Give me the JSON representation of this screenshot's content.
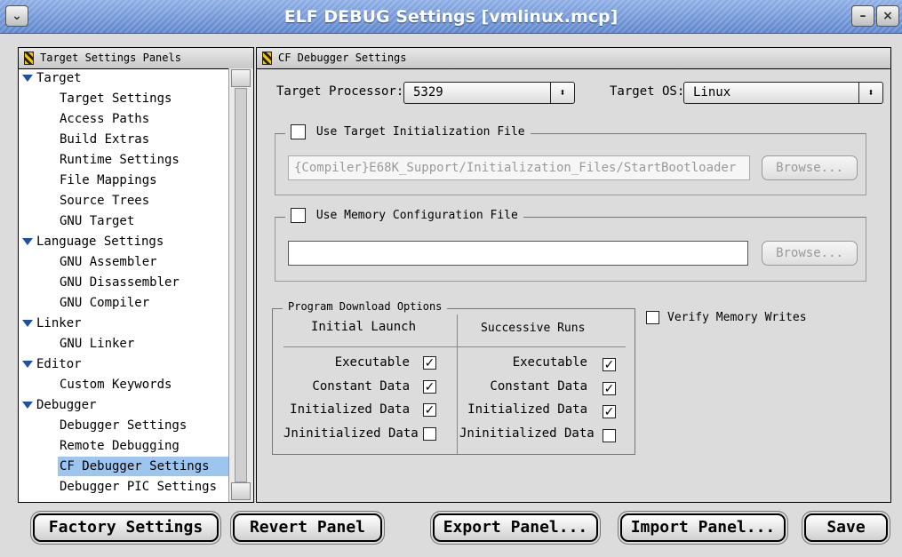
{
  "window": {
    "title": "ELF DEBUG Settings [vmlinux.mcp]",
    "collapse_icon": "collapse-icon",
    "minimize_label": "–",
    "close_label": "×"
  },
  "left_panel": {
    "header": "Target Settings Panels",
    "tree": [
      {
        "label": "Target",
        "level": 0,
        "expanded": true
      },
      {
        "label": "Target Settings",
        "level": 1
      },
      {
        "label": "Access Paths",
        "level": 1
      },
      {
        "label": "Build Extras",
        "level": 1
      },
      {
        "label": "Runtime Settings",
        "level": 1
      },
      {
        "label": "File Mappings",
        "level": 1
      },
      {
        "label": "Source Trees",
        "level": 1
      },
      {
        "label": "GNU Target",
        "level": 1
      },
      {
        "label": "Language Settings",
        "level": 0,
        "expanded": true
      },
      {
        "label": "GNU Assembler",
        "level": 1
      },
      {
        "label": "GNU Disassembler",
        "level": 1
      },
      {
        "label": "GNU Compiler",
        "level": 1
      },
      {
        "label": "Linker",
        "level": 0,
        "expanded": true
      },
      {
        "label": "GNU Linker",
        "level": 1
      },
      {
        "label": "Editor",
        "level": 0,
        "expanded": true
      },
      {
        "label": "Custom Keywords",
        "level": 1
      },
      {
        "label": "Debugger",
        "level": 0,
        "expanded": true
      },
      {
        "label": "Debugger Settings",
        "level": 1
      },
      {
        "label": "Remote Debugging",
        "level": 1
      },
      {
        "label": "CF Debugger Settings",
        "level": 1,
        "selected": true
      },
      {
        "label": "Debugger PIC Settings",
        "level": 1
      }
    ]
  },
  "right_panel": {
    "header": "CF Debugger Settings",
    "target_processor": {
      "label": "Target Processor:",
      "value": "5329"
    },
    "target_os": {
      "label": "Target OS:",
      "value": "Linux"
    },
    "init_file": {
      "label": "Use Target Initialization File",
      "checked": false,
      "path": "{Compiler}E68K_Support/Initialization_Files/StartBootloader",
      "browse": "Browse..."
    },
    "mem_config": {
      "label": "Use Memory Configuration File",
      "checked": false,
      "path": "",
      "browse": "Browse..."
    },
    "download": {
      "legend": "Program Download Options",
      "initial_header": "Initial Launch",
      "successive_header": "Successive Runs",
      "rows": [
        {
          "label": "Executable",
          "initial": true,
          "successive": true
        },
        {
          "label": "Constant Data",
          "initial": true,
          "successive": true
        },
        {
          "label": "Initialized Data",
          "initial": true,
          "successive": true
        },
        {
          "label": "Jninitialized Data",
          "initial": false,
          "successive": false
        }
      ]
    },
    "verify": {
      "label": "Verify Memory Writes",
      "checked": false
    }
  },
  "buttons": {
    "factory": "Factory Settings",
    "revert": "Revert Panel",
    "export": "Export Panel...",
    "import": "Import Panel...",
    "save": "Save"
  },
  "colors": {
    "titlebar": "#6f93d6",
    "selection": "#9cc6f0",
    "tree_triangle": "#1f4fa8"
  }
}
